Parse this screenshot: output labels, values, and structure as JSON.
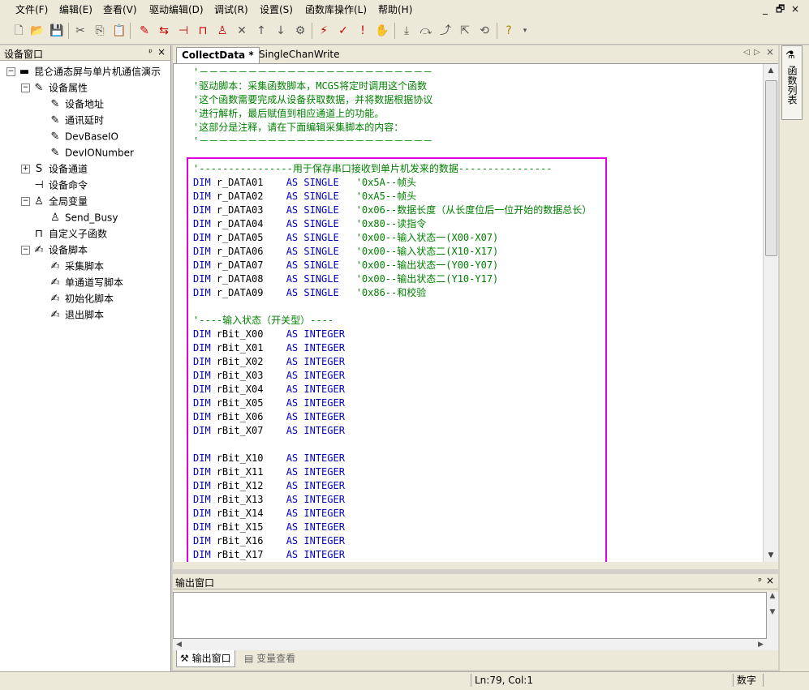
{
  "menu": {
    "items": [
      "文件(F)",
      "编辑(E)",
      "查看(V)",
      "驱动编辑(D)",
      "调试(R)",
      "设置(S)",
      "函数库操作(L)",
      "帮助(H)"
    ],
    "window_controls": [
      "_",
      "🗗",
      "×"
    ]
  },
  "left_panel": {
    "title": "设备窗口",
    "pin": "ᵖ",
    "close": "×",
    "tree": [
      {
        "label": "昆仑通态屏与单片机通信演示",
        "icon": "device-icon",
        "glyph": "▬",
        "exp": "-",
        "level": 0
      },
      {
        "label": "设备属性",
        "icon": "properties-icon",
        "glyph": "✎",
        "exp": "-",
        "level": 1
      },
      {
        "label": "设备地址",
        "icon": "properties-icon",
        "glyph": "✎",
        "exp": "",
        "level": 2
      },
      {
        "label": "通讯延时",
        "icon": "properties-icon",
        "glyph": "✎",
        "exp": "",
        "level": 2
      },
      {
        "label": "DevBaseIO",
        "icon": "properties-icon",
        "glyph": "✎",
        "exp": "",
        "level": 2
      },
      {
        "label": "DevIONumber",
        "icon": "properties-icon",
        "glyph": "✎",
        "exp": "",
        "level": 2
      },
      {
        "label": "设备通道",
        "icon": "channel-icon",
        "glyph": "S",
        "exp": "+",
        "level": 1
      },
      {
        "label": "设备命令",
        "icon": "command-icon",
        "glyph": "⊣",
        "exp": "",
        "level": 1
      },
      {
        "label": "全局变量",
        "icon": "variable-icon",
        "glyph": "♙",
        "exp": "-",
        "level": 1
      },
      {
        "label": "Send_Busy",
        "icon": "variable-icon",
        "glyph": "♙",
        "exp": "",
        "level": 2
      },
      {
        "label": "自定义子函数",
        "icon": "function-icon",
        "glyph": "⊓",
        "exp": "",
        "level": 1
      },
      {
        "label": "设备脚本",
        "icon": "script-icon",
        "glyph": "✍",
        "exp": "-",
        "level": 1
      },
      {
        "label": "采集脚本",
        "icon": "script-icon",
        "glyph": "✍",
        "exp": "",
        "level": 2
      },
      {
        "label": "单通道写脚本",
        "icon": "script-icon",
        "glyph": "✍",
        "exp": "",
        "level": 2
      },
      {
        "label": "初始化脚本",
        "icon": "script-icon",
        "glyph": "✍",
        "exp": "",
        "level": 2
      },
      {
        "label": "退出脚本",
        "icon": "script-icon",
        "glyph": "✍",
        "exp": "",
        "level": 2
      }
    ]
  },
  "editor": {
    "tabs": [
      "CollectData *",
      "SingleChanWrite"
    ],
    "tab_nav": [
      "◁",
      "▷",
      "×"
    ],
    "lines": [
      {
        "t": "cm",
        "s": "'－－－－－－－－－－－－－－－－－－－－－－－－"
      },
      {
        "t": "cm",
        "s": "'驱动脚本：采集函数脚本，MCGS将定时调用这个函数"
      },
      {
        "t": "cm",
        "s": "'这个函数需要完成从设备获取数据，并将数据根据协议"
      },
      {
        "t": "cm",
        "s": "'进行解析，最后赋值到相应通道上的功能。"
      },
      {
        "t": "cm",
        "s": "'这部分是注释，请在下面编辑采集脚本的内容："
      },
      {
        "t": "cm",
        "s": "'－－－－－－－－－－－－－－－－－－－－－－－－"
      },
      {
        "t": "blank",
        "s": ""
      },
      {
        "t": "cm",
        "s": "'----------------用于保存串口接收到单片机发来的数据----------------"
      },
      {
        "t": "dim",
        "name": "r_DATA01",
        "type": "AS SINGLE",
        "comment": "'0x5A--帧头"
      },
      {
        "t": "dim",
        "name": "r_DATA02",
        "type": "AS SINGLE",
        "comment": "'0xA5--帧头"
      },
      {
        "t": "dim",
        "name": "r_DATA03",
        "type": "AS SINGLE",
        "comment": "'0x06--数据长度（从长度位后一位开始的数据总长）"
      },
      {
        "t": "dim",
        "name": "r_DATA04",
        "type": "AS SINGLE",
        "comment": "'0x80--读指令"
      },
      {
        "t": "dim",
        "name": "r_DATA05",
        "type": "AS SINGLE",
        "comment": "'0x00--输入状态一(X00-X07)"
      },
      {
        "t": "dim",
        "name": "r_DATA06",
        "type": "AS SINGLE",
        "comment": "'0x00--输入状态二(X10-X17)"
      },
      {
        "t": "dim",
        "name": "r_DATA07",
        "type": "AS SINGLE",
        "comment": "'0x00--输出状态一(Y00-Y07)"
      },
      {
        "t": "dim",
        "name": "r_DATA08",
        "type": "AS SINGLE",
        "comment": "'0x00--输出状态二(Y10-Y17)"
      },
      {
        "t": "dim",
        "name": "r_DATA09",
        "type": "AS SINGLE",
        "comment": "'0x86--和校验"
      },
      {
        "t": "blank",
        "s": ""
      },
      {
        "t": "cm",
        "s": "'----输入状态（开关型）----"
      },
      {
        "t": "dim",
        "name": "rBit_X00",
        "type": "AS INTEGER",
        "comment": ""
      },
      {
        "t": "dim",
        "name": "rBit_X01",
        "type": "AS INTEGER",
        "comment": ""
      },
      {
        "t": "dim",
        "name": "rBit_X02",
        "type": "AS INTEGER",
        "comment": ""
      },
      {
        "t": "dim",
        "name": "rBit_X03",
        "type": "AS INTEGER",
        "comment": ""
      },
      {
        "t": "dim",
        "name": "rBit_X04",
        "type": "AS INTEGER",
        "comment": ""
      },
      {
        "t": "dim",
        "name": "rBit_X05",
        "type": "AS INTEGER",
        "comment": ""
      },
      {
        "t": "dim",
        "name": "rBit_X06",
        "type": "AS INTEGER",
        "comment": ""
      },
      {
        "t": "dim",
        "name": "rBit_X07",
        "type": "AS INTEGER",
        "comment": ""
      },
      {
        "t": "blank",
        "s": ""
      },
      {
        "t": "dim",
        "name": "rBit_X10",
        "type": "AS INTEGER",
        "comment": ""
      },
      {
        "t": "dim",
        "name": "rBit_X11",
        "type": "AS INTEGER",
        "comment": ""
      },
      {
        "t": "dim",
        "name": "rBit_X12",
        "type": "AS INTEGER",
        "comment": ""
      },
      {
        "t": "dim",
        "name": "rBit_X13",
        "type": "AS INTEGER",
        "comment": ""
      },
      {
        "t": "dim",
        "name": "rBit_X14",
        "type": "AS INTEGER",
        "comment": ""
      },
      {
        "t": "dim",
        "name": "rBit_X15",
        "type": "AS INTEGER",
        "comment": ""
      },
      {
        "t": "dim",
        "name": "rBit_X16",
        "type": "AS INTEGER",
        "comment": ""
      },
      {
        "t": "dim",
        "name": "rBit_X17",
        "type": "AS INTEGER",
        "comment": ""
      }
    ],
    "keyword_dim": "DIM",
    "highlight_color": "#e000e0"
  },
  "right_panel": {
    "func_list_label": "函数列表"
  },
  "output": {
    "title": "输出窗口",
    "pin": "ᵖ",
    "close": "×",
    "tabs": [
      "输出窗口",
      "变量查看"
    ]
  },
  "status": {
    "position": "Ln:79, Col:1",
    "mode": "数字"
  },
  "colors": {
    "comment": "#008000",
    "keyword": "#0000c0"
  }
}
